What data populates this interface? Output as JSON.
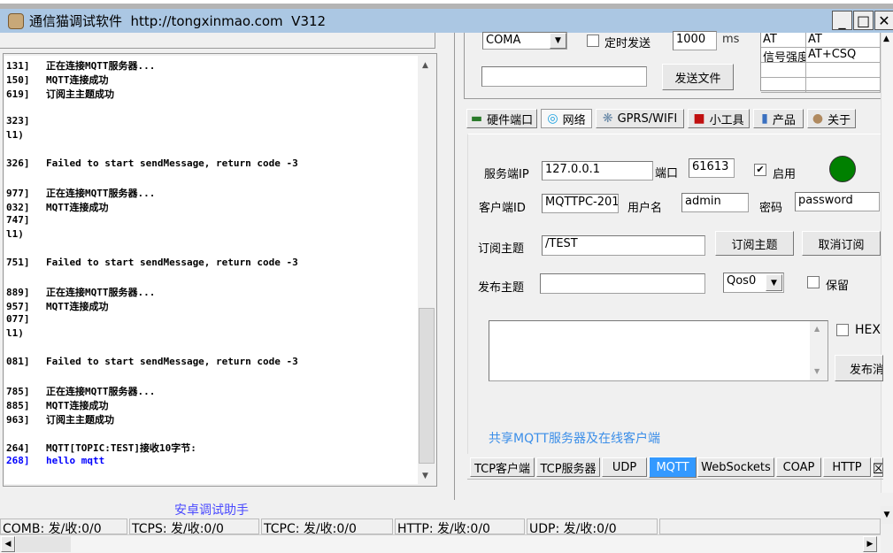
{
  "window": {
    "title": "通信猫调试软件  http://tongxinmao.com  V312",
    "minimize": "_",
    "maximize": "□",
    "close": "✕"
  },
  "log": {
    "lines": [
      {
        "ts": "131]",
        "text": "正在连接MQTT服务器...",
        "color": "#000000"
      },
      {
        "ts": "150]",
        "text": "MQTT连接成功",
        "color": "#000000"
      },
      {
        "ts": "619]",
        "text": "订阅主主题成功",
        "color": "#000000"
      },
      {
        "ts": "",
        "text": "",
        "color": "#000000"
      },
      {
        "ts": "323]",
        "text": "",
        "color": "#000000"
      },
      {
        "ts": "l1)",
        "text": "",
        "color": "#000000"
      },
      {
        "ts": "",
        "text": "",
        "color": "#000000"
      },
      {
        "ts": "326]",
        "text": "Failed to start sendMessage, return code -3",
        "color": "#000000"
      },
      {
        "ts": "",
        "text": "",
        "color": "#000000"
      },
      {
        "ts": "977]",
        "text": "正在连接MQTT服务器...",
        "color": "#000000"
      },
      {
        "ts": "032]",
        "text": "MQTT连接成功",
        "color": "#000000"
      },
      {
        "ts": "747]",
        "text": "",
        "color": "#000000"
      },
      {
        "ts": "l1)",
        "text": "",
        "color": "#000000"
      },
      {
        "ts": "",
        "text": "",
        "color": "#000000"
      },
      {
        "ts": "751]",
        "text": "Failed to start sendMessage, return code -3",
        "color": "#000000"
      },
      {
        "ts": "",
        "text": "",
        "color": "#000000"
      },
      {
        "ts": "889]",
        "text": "正在连接MQTT服务器...",
        "color": "#000000"
      },
      {
        "ts": "957]",
        "text": "MQTT连接成功",
        "color": "#000000"
      },
      {
        "ts": "077]",
        "text": "",
        "color": "#000000"
      },
      {
        "ts": "l1)",
        "text": "",
        "color": "#000000"
      },
      {
        "ts": "",
        "text": "",
        "color": "#000000"
      },
      {
        "ts": "081]",
        "text": "Failed to start sendMessage, return code -3",
        "color": "#000000"
      },
      {
        "ts": "",
        "text": "",
        "color": "#000000"
      },
      {
        "ts": "785]",
        "text": "正在连接MQTT服务器...",
        "color": "#000000"
      },
      {
        "ts": "885]",
        "text": "MQTT连接成功",
        "color": "#000000"
      },
      {
        "ts": "963]",
        "text": "订阅主主题成功",
        "color": "#000000"
      },
      {
        "ts": "",
        "text": "",
        "color": "#000000"
      },
      {
        "ts": "264]",
        "text": "MQTT[TOPIC:TEST]接收10字节:",
        "color": "#000000"
      },
      {
        "ts": "268]",
        "text": "hello mqtt",
        "color": "#0000ff"
      }
    ]
  },
  "android_link": "安卓调试助手",
  "serial": {
    "port": "COMA",
    "timed_send_label": "定时发送",
    "interval": "1000",
    "interval_unit": "ms",
    "file_path": "",
    "send_file": "发送文件"
  },
  "at_table": [
    [
      "AT",
      "AT"
    ],
    [
      "信号强度",
      "AT+CSQ"
    ],
    [
      "",
      ""
    ],
    [
      "",
      ""
    ]
  ],
  "main_tabs": [
    {
      "label": "硬件端口",
      "icon": "circuit-board-icon"
    },
    {
      "label": "网络",
      "icon": "network-icon",
      "active": true
    },
    {
      "label": "GPRS/WIFI",
      "icon": "antenna-icon"
    },
    {
      "label": "小工具",
      "icon": "toolbox-icon"
    },
    {
      "label": "产品",
      "icon": "usb-drive-icon"
    },
    {
      "label": "关于",
      "icon": "cat-icon"
    }
  ],
  "mqtt": {
    "server_ip_label": "服务端IP",
    "server_ip": "127.0.0.1",
    "port_label": "端口",
    "port": "61613",
    "enable_label": "启用",
    "enabled": true,
    "status_color": "#008000",
    "client_id_label": "客户端ID",
    "client_id": "MQTTPC-201",
    "username_label": "用户名",
    "username": "admin",
    "password_label": "密码",
    "password": "password",
    "subscribe_label": "订阅主题",
    "subscribe_topic": "/TEST",
    "subscribe_button": "订阅主题",
    "unsubscribe_button": "取消订阅",
    "publish_label": "发布主题",
    "publish_topic": "",
    "qos": "Qos0",
    "retain_label": "保留",
    "retain": false,
    "message": "",
    "hex_label": "HEX",
    "hex": false,
    "publish_button": "发布消",
    "shared_link": "共享MQTT服务器及在线客户端"
  },
  "protocol_tabs": [
    {
      "label": "TCP客户端"
    },
    {
      "label": "TCP服务器"
    },
    {
      "label": "UDP"
    },
    {
      "label": "MQTT",
      "active": true
    },
    {
      "label": "WebSockets"
    },
    {
      "label": "COAP"
    },
    {
      "label": "HTTP"
    },
    {
      "label": "区"
    }
  ],
  "status_bar": [
    "COMB: 发/收:0/0",
    "TCPS: 发/收:0/0",
    "TCPC: 发/收:0/0",
    "HTTP: 发/收:0/0",
    "UDP: 发/收:0/0",
    ""
  ],
  "colors": {
    "titlebar": "#abc7e3",
    "active_tab": "#3399ff",
    "link": "#3b8ee8"
  }
}
